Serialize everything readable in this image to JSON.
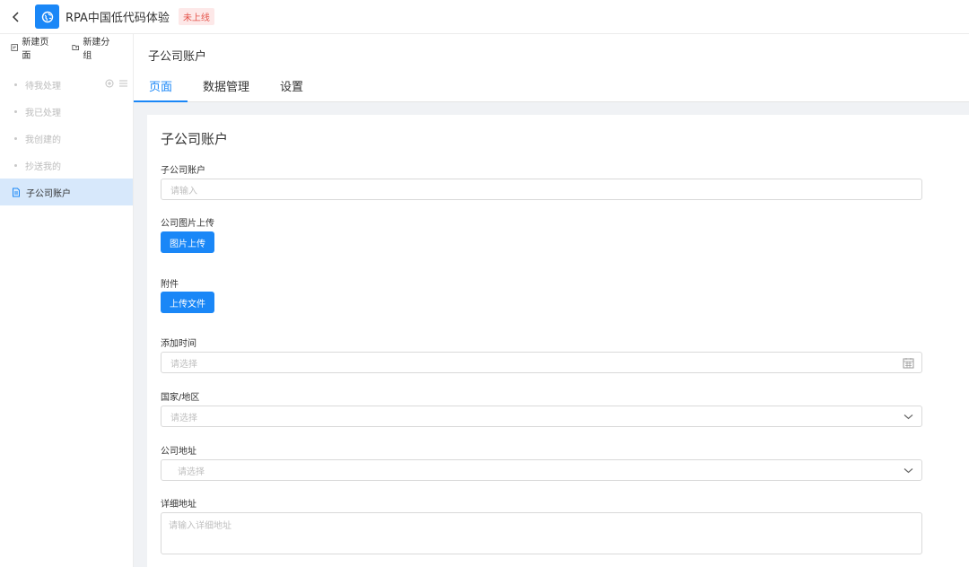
{
  "header": {
    "app_title": "RPA中国低代码体验",
    "status_badge": "未上线"
  },
  "sidebar": {
    "actions": [
      {
        "label": "新建页面"
      },
      {
        "label": "新建分组"
      }
    ],
    "items": [
      {
        "label": "待我处理"
      },
      {
        "label": "我已处理"
      },
      {
        "label": "我创建的"
      },
      {
        "label": "抄送我的"
      },
      {
        "label": "子公司账户"
      }
    ]
  },
  "content": {
    "title": "子公司账户",
    "tabs": [
      {
        "label": "页面"
      },
      {
        "label": "数据管理"
      },
      {
        "label": "设置"
      }
    ]
  },
  "form": {
    "title": "子公司账户",
    "account": {
      "label": "子公司账户",
      "placeholder": "请输入"
    },
    "image_upload": {
      "label": "公司图片上传",
      "button": "图片上传"
    },
    "attachment": {
      "label": "附件",
      "button": "上传文件"
    },
    "add_time": {
      "label": "添加时间",
      "placeholder": "请选择"
    },
    "country": {
      "label": "国家/地区",
      "placeholder": "请选择"
    },
    "address": {
      "label": "公司地址",
      "placeholder": "请选择"
    },
    "detail_address": {
      "label": "详细地址",
      "placeholder": "请输入详细地址"
    }
  },
  "colors": {
    "primary": "#1a87f7",
    "badge_bg": "#fde8e8",
    "badge_text": "#e5544b",
    "active_item_bg": "#d7e8fb",
    "page_bg": "#f0f2f5"
  }
}
